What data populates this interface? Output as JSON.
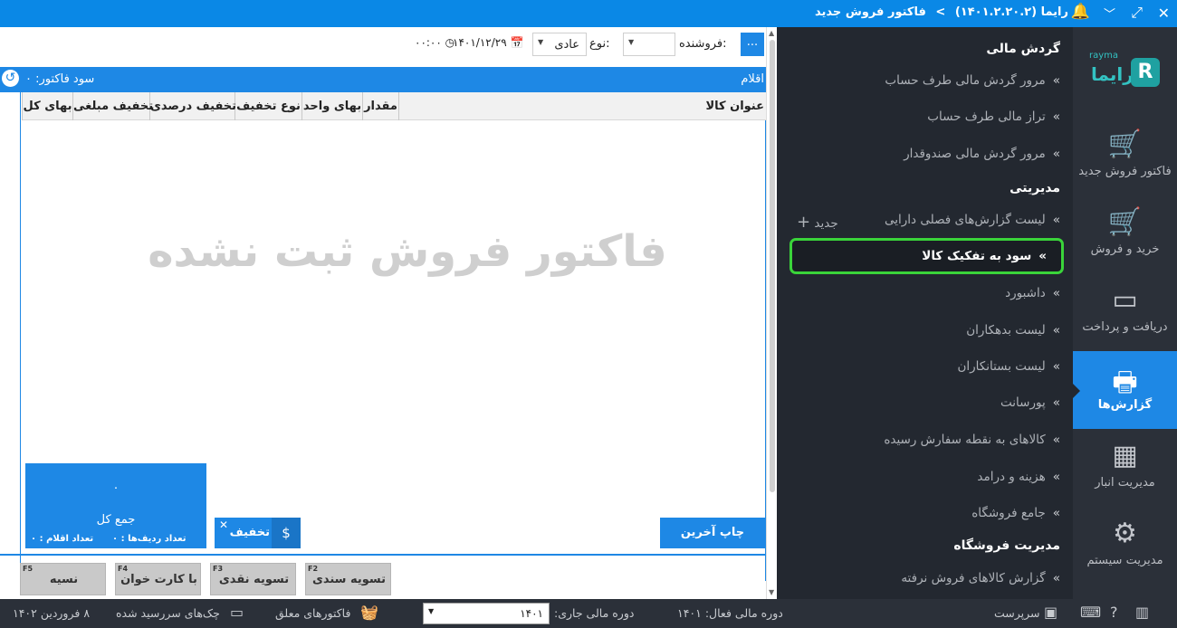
{
  "titlebar": {
    "app_name": "رایما",
    "version": "(۱۴۰۱.۲.۲۰.۲)",
    "page_title": "فاکتور فروش جدید",
    "separator": ">"
  },
  "toolbar": {
    "more_button": "...",
    "seller_label": "فروشنده:",
    "seller_value": "",
    "type_label": "نوع:",
    "type_value": "عادی",
    "date_value": "۱۴۰۱/۱۲/۲۹",
    "time_value": "۰۰:۰۰"
  },
  "invoice": {
    "items_header": "اقلام",
    "profit_label": "سود فاکتور: ۰",
    "columns": [
      "عنوان کالا",
      "مقدار",
      "بهای واحد",
      "نوع تخفیف",
      "تخفیف درصدی",
      "تخفیف مبلغی",
      "بهای کل"
    ],
    "empty_message": "فاکتور فروش ثبت نشده",
    "total_value": "۰",
    "total_label": "جمع کل",
    "row_count": "تعداد ردیف‌ها : ۰",
    "item_count": "تعداد اقلام : ۰",
    "discount_button": "تخفیف",
    "discount_icon": "$",
    "print_last_button": "چاپ آخرین فاکتور"
  },
  "function_buttons": [
    {
      "key": "F2",
      "label": "تسویه سندی"
    },
    {
      "key": "F3",
      "label": "تسویه نقدی"
    },
    {
      "key": "F4",
      "label": "با کارت خوان"
    },
    {
      "key": "F5",
      "label": "نسیه"
    }
  ],
  "menu": {
    "section_financial": "گردش مالی",
    "financial_items": [
      "مرور گردش مالی طرف حساب",
      "تراز مالی طرف حساب",
      "مرور گردش مالی صندوقدار"
    ],
    "section_management": "مدیریتی",
    "management_first": "لیست گزارش‌های فصلی دارایی",
    "new_link": "جدید",
    "active_item": "سود به تفکیک کالا",
    "management_items": [
      "داشبورد",
      "لیست بدهکاران",
      "لیست بستانکاران",
      "پورسانت",
      "کالاهای به نقطه سفارش رسیده",
      "هزینه و درامد",
      "جامع فروشگاه"
    ],
    "section_store": "مدیریت فروشگاه",
    "store_items": [
      "گزارش کالاهای فروش نرفته"
    ]
  },
  "sidebar": {
    "logo_small": "rayma",
    "logo_name": "رایما",
    "items": [
      {
        "label": "فاکتور فروش جدید",
        "icon": "cart-add-icon"
      },
      {
        "label": "خرید و فروش",
        "icon": "cart-icon"
      },
      {
        "label": "دریافت و پرداخت",
        "icon": "card-icon"
      },
      {
        "label": "گزارش‌ها",
        "icon": "printer-icon"
      },
      {
        "label": "مدیریت انبار",
        "icon": "grid-icon"
      },
      {
        "label": "مدیریت سیستم",
        "icon": "gear-icon"
      }
    ]
  },
  "statusbar": {
    "user": "سرپرست",
    "active_period": "دوره مالی فعال: ۱۴۰۱",
    "current_period_label": "دوره مالی جاری:",
    "current_period_value": "۱۴۰۱",
    "pending_invoices": "فاکتورهای معلق",
    "due_cheques": "چک‌های سررسید شده",
    "date": "۸ فروردین ۱۴۰۲"
  },
  "colors": {
    "titlebar": "#0a88e6",
    "accent": "#1e88e5",
    "menu_bg": "#232830",
    "sidebar_bg": "#2b3039",
    "active_outline": "#3ad43a"
  }
}
